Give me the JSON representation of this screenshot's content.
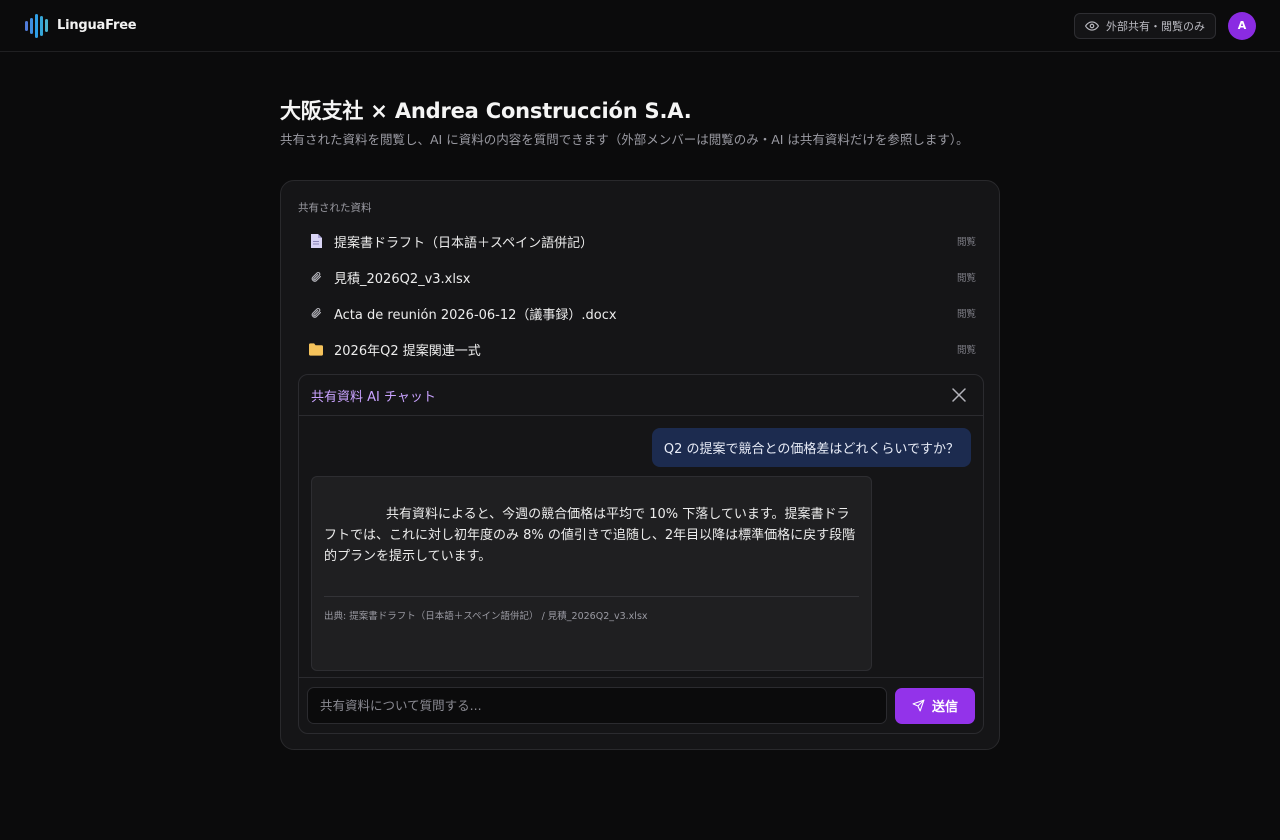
{
  "app": {
    "brand_name": "LinguaFree",
    "share_status": "外部共有・閲覧のみ",
    "avatar_initial": "A",
    "accent_color": "#9333ea"
  },
  "page": {
    "title": "大阪支社 × Andrea Construcción S.A.",
    "subtitle": "共有された資料を閲覧し、AI に資料の内容を質問できます（外部メンバーは閲覧のみ・AI は共有資料だけを参照します）。"
  },
  "shared_files": {
    "label": "共有された資料",
    "items": [
      {
        "name": "提案書ドラフト（日本語＋スペイン語併記）",
        "icon": "document-icon",
        "permission": "閲覧"
      },
      {
        "name": "見積_2026Q2_v3.xlsx",
        "icon": "paperclip-icon",
        "permission": "閲覧"
      },
      {
        "name": "Acta de reunión 2026-06-12（議事録）.docx",
        "icon": "paperclip-icon",
        "permission": "閲覧"
      },
      {
        "name": "2026年Q2 提案関連一式",
        "icon": "folder-icon",
        "permission": "閲覧"
      }
    ]
  },
  "chat": {
    "title": "共有資料 AI チャット",
    "user_message": "Q2 の提案で競合との価格差はどれくらいですか？",
    "ai_message": "共有資料によると、今週の競合価格は平均で 10% 下落しています。提案書ドラフトでは、これに対し初年度のみ 8% の値引きで追随し、2年目以降は標準価格に戻す段階的プランを提示しています。",
    "ai_source": "出典: 提案書ドラフト（日本語＋スペイン語併記） / 見積_2026Q2_v3.xlsx",
    "input_value": "",
    "input_placeholder": "共有資料について質問する...",
    "send_label": "送信"
  }
}
